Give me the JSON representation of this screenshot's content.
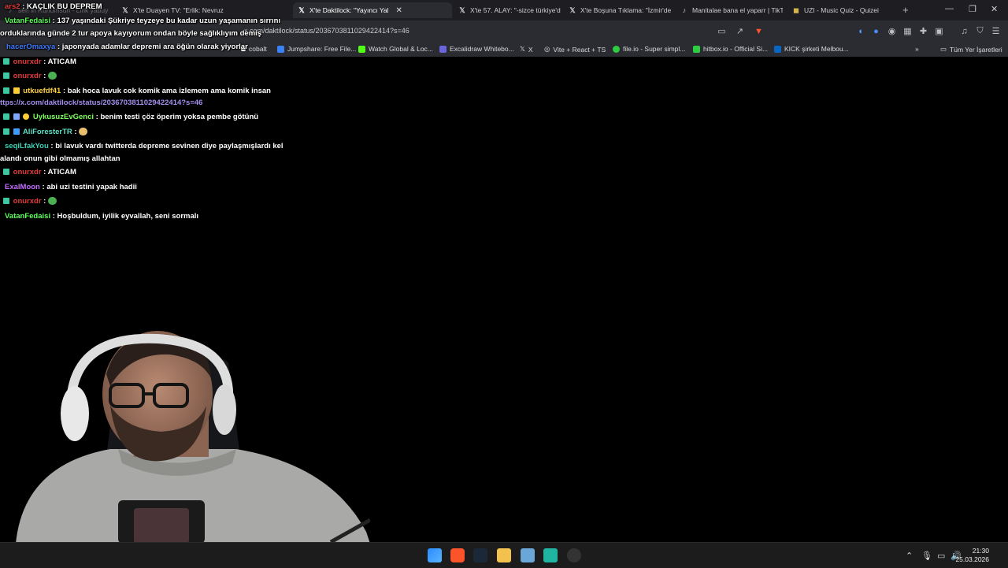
{
  "browser": {
    "tabs": [
      {
        "title": "sen in Ruhumsun - Lirik yabuy",
        "icon": "tiktok-icon",
        "state": "faded"
      },
      {
        "title": "X'te Duayen TV: \"Erlik: Nevruz",
        "icon": "x-logo-icon",
        "state": "normal"
      },
      {
        "title": "X'te Daktilock: \"Yayıncı Yal",
        "icon": "x-logo-icon",
        "state": "active"
      },
      {
        "title": "X'te 57. ALAY: \"-sizce türkiye'de",
        "icon": "x-logo-icon",
        "state": "normal"
      },
      {
        "title": "X'te Boşuna Tıklama: \"İzmir'de",
        "icon": "x-logo-icon",
        "state": "normal"
      },
      {
        "title": "Manitalae bana el yaparr | TikT",
        "icon": "tiktok-icon",
        "state": "normal"
      },
      {
        "title": "UZI - Music Quiz - Quizei",
        "icon": "quiz-icon",
        "state": "normal"
      }
    ],
    "url": "x.com/daktilock/status/2036703811029422414?s=46",
    "bookmarks": [
      {
        "label": "cobalt",
        "color": "#ffffff"
      },
      {
        "label": "Jumpshare: Free File...",
        "color": "#3b82f6"
      },
      {
        "label": "Watch Global & Loc...",
        "color": "#53fc18"
      },
      {
        "label": "Excalidraw Whitebo...",
        "color": "#6965db"
      },
      {
        "label": "X",
        "color": "#ffffff"
      },
      {
        "label": "Vite + React + TS",
        "color": "#bbbbbb"
      },
      {
        "label": "file.io - Super simpl...",
        "color": "#ffffff"
      },
      {
        "label": "hitbox.io - Official Si...",
        "color": "#2ecc40"
      },
      {
        "label": "KICK şirketi Melbou...",
        "color": "#0a66c2"
      }
    ],
    "all_bookmarks_label": "Tüm Yer İşaretleri"
  },
  "chat": [
    {
      "user": "ars2",
      "color": "#e23c3c",
      "text": ": KAÇLIK BU DEPREM"
    },
    {
      "user": "VatanFedaisi",
      "color": "#5cff5c",
      "text": ": 137 yaşındaki Şükriye teyzeye bu kadar uzun yaşamanın sırrını"
    },
    {
      "user": "",
      "color": "#ffffff",
      "text": "orduklarında günde 2 tur apoya kayıyorum ondan böyle sağlıklıyım demiş"
    },
    {
      "user": "hacerOmaxya",
      "color": "#3e7bff",
      "text": ": japonyada adamlar depremi ara öğün olarak yiyorlar"
    },
    {
      "user": "onurxdr",
      "color": "#e23c3c",
      "text": ": ATICAM"
    },
    {
      "user": "onurxdr",
      "color": "#e23c3c",
      "text": ":"
    },
    {
      "user": "utkuefdf41",
      "color": "#ffd23c",
      "text": ": bak hoca lavuk cok komik ama izlemem ama komik insan"
    },
    {
      "user": "",
      "color": "#a48ff0",
      "text": "ttps://x.com/daktilock/status/2036703811029422414?s=46"
    },
    {
      "user": "UykusuzEvGenci",
      "color": "#7dff5c",
      "text": ": benim testi çöz öperim yoksa pembe götünü"
    },
    {
      "user": "AliForesterTR",
      "color": "#5ee0c8",
      "text": ":"
    },
    {
      "user": "seqiLfakYou",
      "color": "#37d3b6",
      "text": ": bi lavuk vardı twitterda depreme sevinen diye paylaşmışlardı kel"
    },
    {
      "user": "",
      "color": "#ffffff",
      "text": "alandı onun gibi olmamış allahtan"
    },
    {
      "user": "onurxdr",
      "color": "#e23c3c",
      "text": ": ATICAM"
    },
    {
      "user": "ExalMoon",
      "color": "#c36bff",
      "text": ": abi uzi testini yapak hadii"
    },
    {
      "user": "onurxdr",
      "color": "#e23c3c",
      "text": ":"
    },
    {
      "user": "VatanFedaisi",
      "color": "#5cff5c",
      "text": ": Hoşbuldum, iyilik eyvallah, seni sormalı"
    }
  ],
  "taskbar": {
    "time": "21:30",
    "date": "25.03.2026"
  }
}
